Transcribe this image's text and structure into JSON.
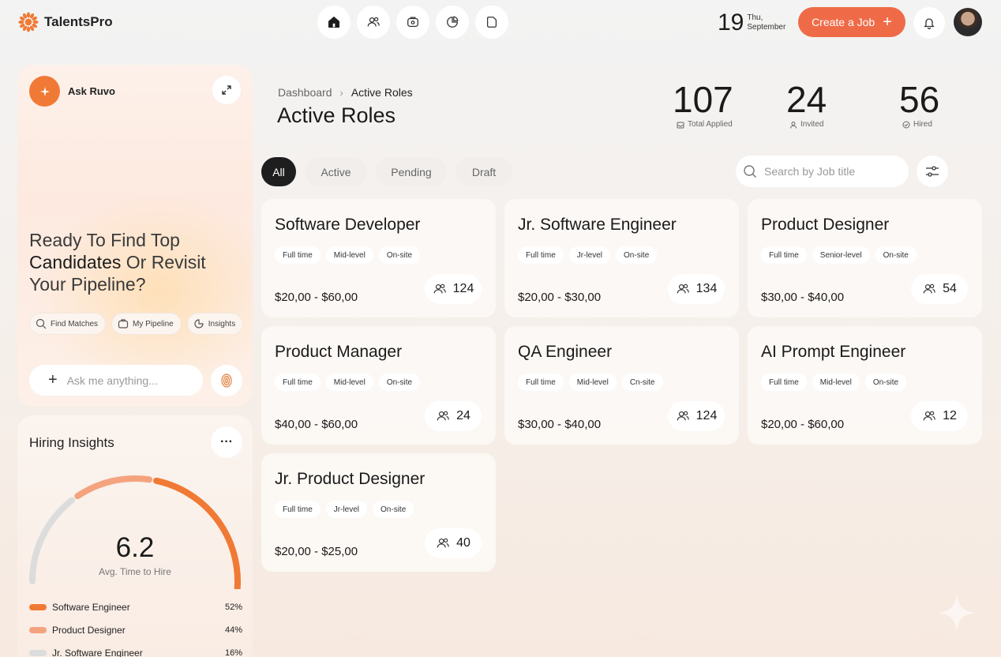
{
  "header": {
    "brand": "TalentsPro",
    "nav": [
      {
        "icon": "home-icon"
      },
      {
        "icon": "users-icon"
      },
      {
        "icon": "briefcase-icon"
      },
      {
        "icon": "pie-chart-icon"
      },
      {
        "icon": "document-icon"
      }
    ],
    "date_day": "19",
    "date_weekday": "Thu,",
    "date_month": "September",
    "create_job_label": "Create a Job",
    "accent_color": "#ef6b47"
  },
  "ruvo": {
    "title": "Ask Ruvo",
    "headline_1": "Ready To Find Top",
    "headline_2_bold": "Candidates",
    "headline_2_rest": " Or Revisit",
    "headline_3": "Your Pipeline?",
    "chips": [
      {
        "label": "Find Matches",
        "icon": "search-icon"
      },
      {
        "label": "My Pipeline",
        "icon": "briefcase-icon"
      },
      {
        "label": "Insights",
        "icon": "pie-chart-icon"
      }
    ],
    "input_placeholder": "Ask me anything..."
  },
  "insights": {
    "title": "Hiring Insights",
    "gauge_value": "6.2",
    "gauge_label": "Avg. Time to Hire",
    "segments": [
      {
        "name": "Software Engineer",
        "pct": "52%",
        "fraction": 0.52,
        "color": "#f07a35"
      },
      {
        "name": "Product Designer",
        "pct": "44%",
        "fraction": 0.44,
        "color": "#f4a37f"
      },
      {
        "name": "Jr. Software Engineer",
        "pct": "16%",
        "fraction": 0.16,
        "color": "#dcdcdc"
      }
    ]
  },
  "main": {
    "breadcrumb_home": "Dashboard",
    "breadcrumb_current": "Active Roles",
    "title": "Active Roles",
    "stats": [
      {
        "value": "107",
        "label": "Total Applied",
        "icon": "inbox-icon"
      },
      {
        "value": "24",
        "label": "Invited",
        "icon": "user-icon"
      },
      {
        "value": "56",
        "label": "Hired",
        "icon": "check-circle-icon"
      }
    ],
    "tabs": [
      "All",
      "Active",
      "Pending",
      "Draft"
    ],
    "active_tab": "All",
    "search_placeholder": "Search by Job title",
    "jobs": [
      {
        "title": "Software Developer",
        "tags": [
          "Full time",
          "Mid-level",
          "On-site"
        ],
        "salary": "$20,00 - $60,00",
        "applicants": "124"
      },
      {
        "title": "Jr. Software Engineer",
        "tags": [
          "Full time",
          "Jr-level",
          "On-site"
        ],
        "salary": "$20,00 - $30,00",
        "applicants": "134"
      },
      {
        "title": "Product Designer",
        "tags": [
          "Full time",
          "Senior-level",
          "On-site"
        ],
        "salary": "$30,00 - $40,00",
        "applicants": "54"
      },
      {
        "title": "Product Manager",
        "tags": [
          "Full time",
          "Mid-level",
          "On-site"
        ],
        "salary": "$40,00 - $60,00",
        "applicants": "24"
      },
      {
        "title": "QA Engineer",
        "tags": [
          "Full time",
          "Mid-level",
          "Cn-site"
        ],
        "salary": "$30,00 - $40,00",
        "applicants": "124"
      },
      {
        "title": "AI Prompt Engineer",
        "tags": [
          "Full time",
          "Mid-level",
          "On-site"
        ],
        "salary": "$20,00 - $60,00",
        "applicants": "12"
      },
      {
        "title": "Jr. Product Designer",
        "tags": [
          "Full time",
          "Jr-level",
          "On-site"
        ],
        "salary": "$20,00 - $25,00",
        "applicants": "40"
      }
    ]
  }
}
